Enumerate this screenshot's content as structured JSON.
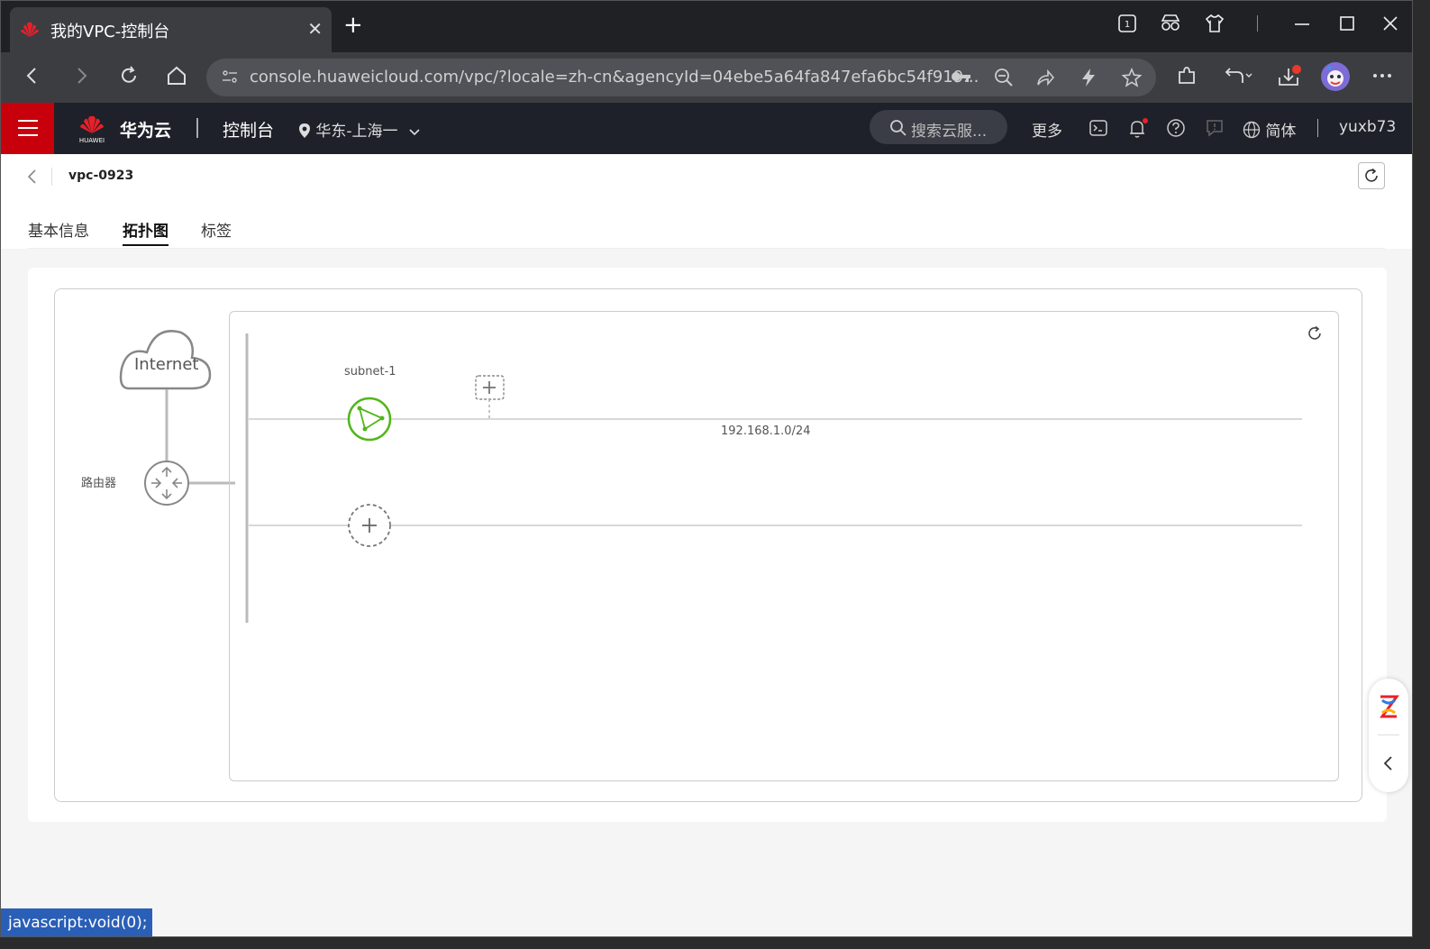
{
  "browser": {
    "tab_title": "我的VPC-控制台",
    "tab_close": "✕",
    "new_tab": "+",
    "url": "console.huaweicloud.com/vpc/?locale=zh-cn&agencyId=04ebe5a64fa847efa6bc54f919...",
    "status_text": "javascript:void(0);"
  },
  "header": {
    "brand": "华为云",
    "console": "控制台",
    "region": "华东-上海一",
    "search_placeholder": "搜索云服...",
    "more": "更多",
    "language": "简体",
    "user": "yuxb73"
  },
  "page": {
    "title": "vpc-0923",
    "tabs": [
      "基本信息",
      "拓扑图",
      "标签"
    ],
    "active_tab": "拓扑图"
  },
  "topology": {
    "internet": "Internet",
    "router": "路由器",
    "subnet_name": "subnet-1",
    "subnet_cidr": "192.168.1.0/24"
  },
  "colors": {
    "brand_red": "#c7000b",
    "subnet_green": "#52b61a",
    "header_bg": "#1e2129",
    "status_blue": "#2a5fb7"
  },
  "icons": [
    "huawei-logo-icon",
    "back-icon",
    "forward-icon",
    "reload-icon",
    "home-icon",
    "site-info-icon",
    "key-icon",
    "zoom-out-icon",
    "share-icon",
    "bolt-icon",
    "star-icon",
    "extensions-icon",
    "undo-icon",
    "download-icon",
    "avatar",
    "more-icon",
    "menu-icon",
    "location-icon",
    "chevron-down-icon",
    "search-icon",
    "terminal-icon",
    "bell-icon",
    "help-icon",
    "feedback-icon",
    "globe-icon",
    "refresh-icon",
    "cloud-icon",
    "router-icon",
    "subnet-icon",
    "add-icon",
    "collapse-icon"
  ]
}
